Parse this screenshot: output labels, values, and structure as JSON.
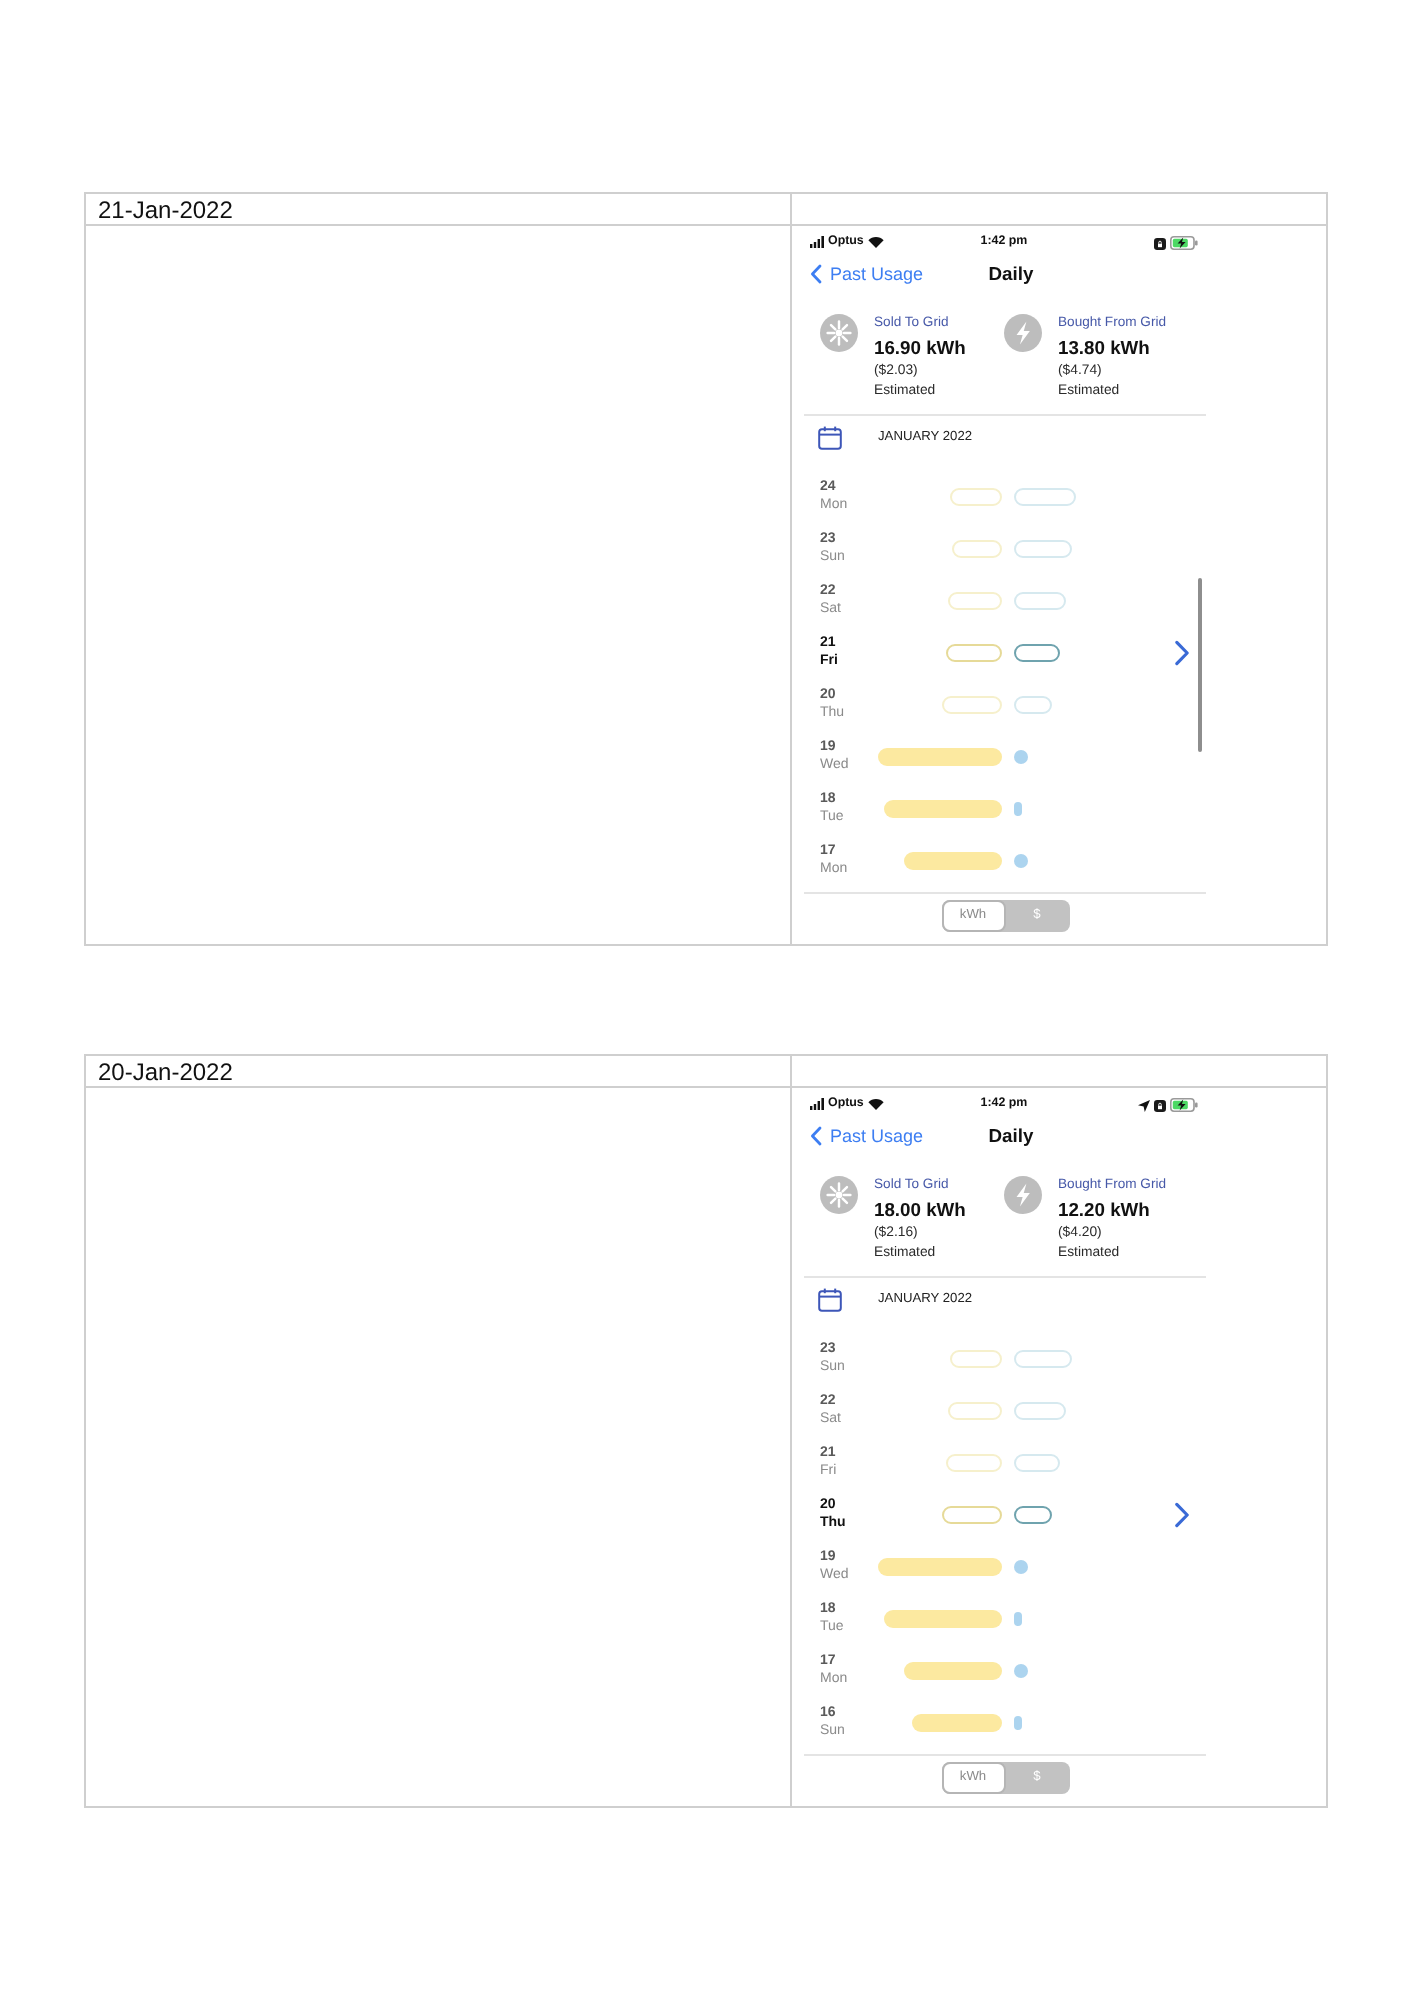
{
  "sections": [
    {
      "date": "21-Jan-2022",
      "screenshot": {
        "status_bar": {
          "carrier": "Optus",
          "time": "1:42 pm",
          "location_icon": false
        },
        "nav": {
          "back": "Past Usage",
          "title": "Daily"
        },
        "summary": [
          {
            "kind": "sold",
            "label": "Sold To Grid",
            "amount": "16.90 kWh",
            "cost": "($2.03)",
            "note": "Estimated"
          },
          {
            "kind": "bought",
            "label": "Bought From Grid",
            "amount": "13.80 kWh",
            "cost": "($4.74)",
            "note": "Estimated"
          }
        ],
        "month": "JANUARY 2022",
        "days": [
          {
            "day": "24",
            "weekday": "Mon",
            "kind": "pending",
            "selected": false
          },
          {
            "day": "23",
            "weekday": "Sun",
            "kind": "pending",
            "selected": false
          },
          {
            "day": "22",
            "weekday": "Sat",
            "kind": "pending",
            "selected": false
          },
          {
            "day": "21",
            "weekday": "Fri",
            "kind": "pending",
            "selected": true
          },
          {
            "day": "20",
            "weekday": "Thu",
            "kind": "pending",
            "selected": false
          },
          {
            "day": "19",
            "weekday": "Wed",
            "kind": "actual",
            "selected": false
          },
          {
            "day": "18",
            "weekday": "Tue",
            "kind": "actual",
            "selected": false
          },
          {
            "day": "17",
            "weekday": "Mon",
            "kind": "actual",
            "selected": false
          }
        ],
        "scroll_indicator": true,
        "units": [
          {
            "label": "kWh",
            "selected": true
          },
          {
            "label": "$",
            "selected": false
          }
        ]
      }
    },
    {
      "date": "20-Jan-2022",
      "screenshot": {
        "status_bar": {
          "carrier": "Optus",
          "time": "1:42 pm",
          "location_icon": true
        },
        "nav": {
          "back": "Past Usage",
          "title": "Daily"
        },
        "summary": [
          {
            "kind": "sold",
            "label": "Sold To Grid",
            "amount": "18.00 kWh",
            "cost": "($2.16)",
            "note": "Estimated"
          },
          {
            "kind": "bought",
            "label": "Bought From Grid",
            "amount": "12.20 kWh",
            "cost": "($4.20)",
            "note": "Estimated"
          }
        ],
        "month": "JANUARY 2022",
        "days": [
          {
            "day": "23",
            "weekday": "Sun",
            "kind": "pending",
            "selected": false
          },
          {
            "day": "22",
            "weekday": "Sat",
            "kind": "pending",
            "selected": false
          },
          {
            "day": "21",
            "weekday": "Fri",
            "kind": "pending",
            "selected": false
          },
          {
            "day": "20",
            "weekday": "Thu",
            "kind": "pending",
            "selected": true
          },
          {
            "day": "19",
            "weekday": "Wed",
            "kind": "actual",
            "selected": false
          },
          {
            "day": "18",
            "weekday": "Tue",
            "kind": "actual",
            "selected": false
          },
          {
            "day": "17",
            "weekday": "Mon",
            "kind": "actual",
            "selected": false
          },
          {
            "day": "16",
            "weekday": "Sun",
            "kind": "actual",
            "selected": false
          }
        ],
        "scroll_indicator": false,
        "units": [
          {
            "label": "kWh",
            "selected": true
          },
          {
            "label": "$",
            "selected": false
          }
        ]
      }
    }
  ]
}
